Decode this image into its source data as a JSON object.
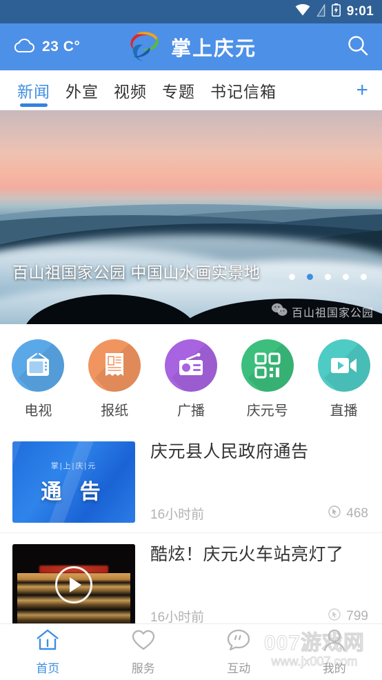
{
  "status_bar": {
    "time": "9:01",
    "icons": [
      "wifi-icon",
      "signal-icon",
      "battery-charging-icon"
    ],
    "background": "#2f6095"
  },
  "header": {
    "weather_icon": "cloud-icon",
    "temperature": "23 C°",
    "brand_name": "掌上庆元",
    "logo_icon": "swirl-logo-icon",
    "search_icon": "search-icon",
    "accent": "#4d90e8"
  },
  "tabs": {
    "items": [
      {
        "label": "新闻",
        "active": true
      },
      {
        "label": "外宣",
        "active": false
      },
      {
        "label": "视频",
        "active": false
      },
      {
        "label": "专题",
        "active": false
      },
      {
        "label": "书记信箱",
        "active": false
      }
    ],
    "add_label": "+",
    "active_color": "#3e8ee0"
  },
  "banner": {
    "caption": "百山祖国家公园 中国山水画实景地",
    "watermark_text": "百山祖国家公园",
    "watermark_icon": "wechat-icon",
    "dots": 5,
    "active_dot": 2
  },
  "quick_links": [
    {
      "label": "电视",
      "icon": "tv-icon",
      "color": "#5aa8e8"
    },
    {
      "label": "报纸",
      "icon": "newspaper-icon",
      "color": "#f0955f"
    },
    {
      "label": "广播",
      "icon": "radio-icon",
      "color": "#a763e0"
    },
    {
      "label": "庆元号",
      "icon": "qrcode-icon",
      "color": "#3cbf7c"
    },
    {
      "label": "直播",
      "icon": "video-camera-icon",
      "color": "#4ecbc4"
    }
  ],
  "news": [
    {
      "title": "庆元县人民政府通告",
      "time": "16小时前",
      "views": "468",
      "views_icon": "view-count-icon",
      "thumb_type": "notice",
      "thumb_sub": "掌|上|庆|元",
      "thumb_main": "通 告"
    },
    {
      "title": "酷炫！庆元火车站亮灯了",
      "time": "16小时前",
      "views": "799",
      "views_icon": "view-count-icon",
      "thumb_type": "video",
      "play_icon": "play-icon"
    }
  ],
  "bottom_nav": [
    {
      "label": "首页",
      "icon": "home-icon",
      "active": true
    },
    {
      "label": "服务",
      "icon": "heart-icon",
      "active": false
    },
    {
      "label": "互动",
      "icon": "chat-bubble-icon",
      "active": false
    },
    {
      "label": "我的",
      "icon": "person-icon",
      "active": false
    }
  ],
  "site_watermark": {
    "line1": "007游戏网",
    "line2": "www.jx007.com"
  }
}
